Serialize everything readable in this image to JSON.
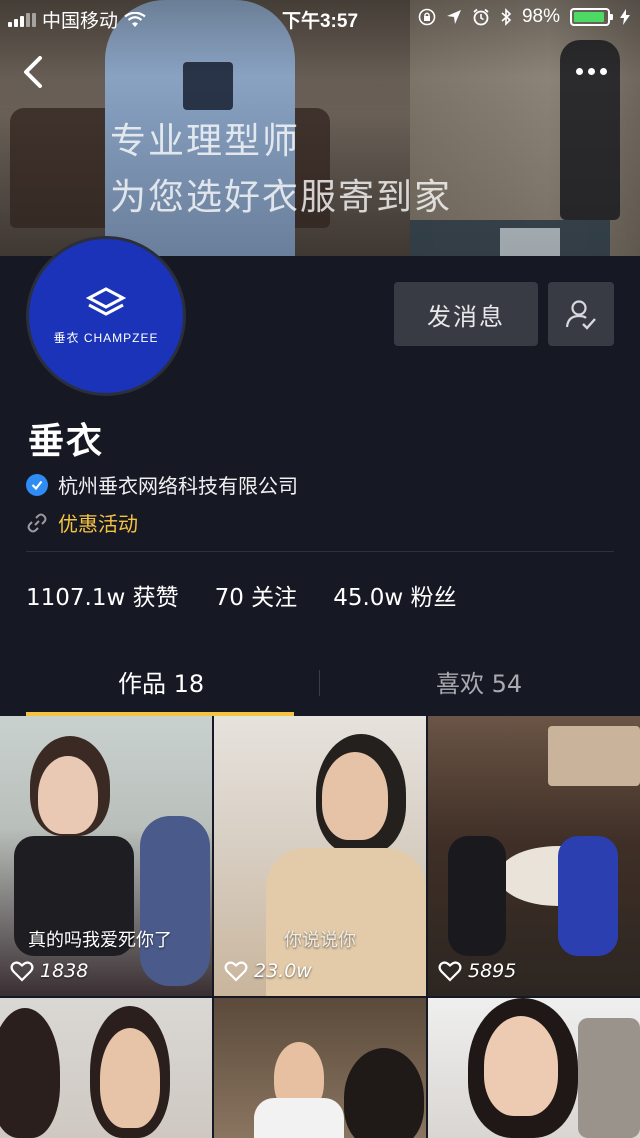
{
  "status_bar": {
    "carrier": "中国移动",
    "time": "下午3:57",
    "battery": "98%",
    "battery_level": 0.98
  },
  "banner": {
    "line1": "专业理型师",
    "line2": "为您选好衣服寄到家"
  },
  "profile": {
    "avatar_text": "垂衣 CHAMPZEE",
    "message_button": "发消息",
    "name": "垂衣",
    "verified_org": "杭州垂衣网络科技有限公司",
    "promo_link": "优惠活动"
  },
  "stats": {
    "likes": "1107.1w 获赞",
    "following": "70 关注",
    "followers": "45.0w 粉丝"
  },
  "tabs": {
    "works": "作品 18",
    "liked": "喜欢 54"
  },
  "videos": [
    {
      "caption": "真的吗我爱死你了",
      "likes": "1838"
    },
    {
      "caption": "你说说你",
      "likes": "23.0w"
    },
    {
      "caption": "",
      "likes": "5895"
    }
  ],
  "colors": {
    "background": "#161823",
    "accent": "#f5c342",
    "verify": "#2f8cf5",
    "battery": "#4cd964"
  }
}
